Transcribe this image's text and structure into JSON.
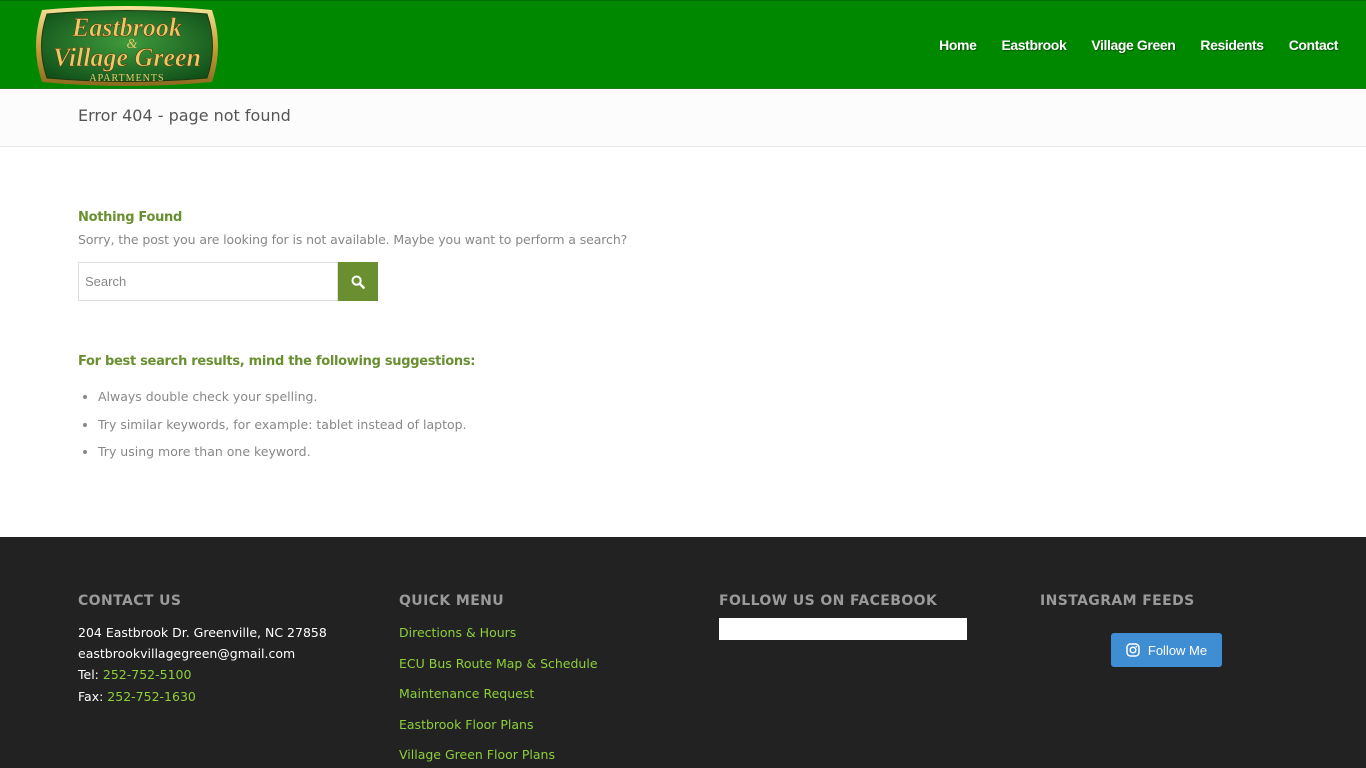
{
  "header": {
    "logo": {
      "line1": "Eastbrook",
      "amp": "&",
      "line2": "Village Green",
      "line3": "APARTMENTS"
    },
    "nav": [
      "Home",
      "Eastbrook",
      "Village Green",
      "Residents",
      "Contact"
    ]
  },
  "title_bar": {
    "title": "Error 404 - page not found"
  },
  "main": {
    "heading": "Nothing Found",
    "message": "Sorry, the post you are looking for is not available. Maybe you want to perform a search?",
    "search": {
      "placeholder": "Search",
      "value": ""
    },
    "suggest_title": "For best search results, mind the following suggestions:",
    "suggestions": [
      "Always double check your spelling.",
      "Try similar keywords, for example: tablet instead of laptop.",
      "Try using more than one keyword."
    ]
  },
  "footer": {
    "contact": {
      "heading": "CONTACT US",
      "address": "204 Eastbrook Dr. Greenville, NC 27858",
      "email": "eastbrookvillagegreen@gmail.com",
      "tel_label": "Tel:",
      "tel": "252-752-5100",
      "fax_label": "Fax:",
      "fax": "252-752-1630"
    },
    "quick_menu": {
      "heading": "QUICK MENU",
      "items": [
        "Directions & Hours",
        "ECU Bus Route Map & Schedule",
        "Maintenance Request",
        "Eastbrook Floor Plans",
        "Village Green Floor Plans"
      ]
    },
    "facebook": {
      "heading": "FOLLOW US ON FACEBOOK"
    },
    "instagram": {
      "heading": "INSTAGRAM FEEDS",
      "button_label": "Follow Me"
    }
  },
  "colors": {
    "header_green": "#008800",
    "accent_green": "#6a8f31",
    "link_green": "#8cd03a",
    "footer_bg": "#222222",
    "instagram_blue": "#3f8ed4"
  }
}
